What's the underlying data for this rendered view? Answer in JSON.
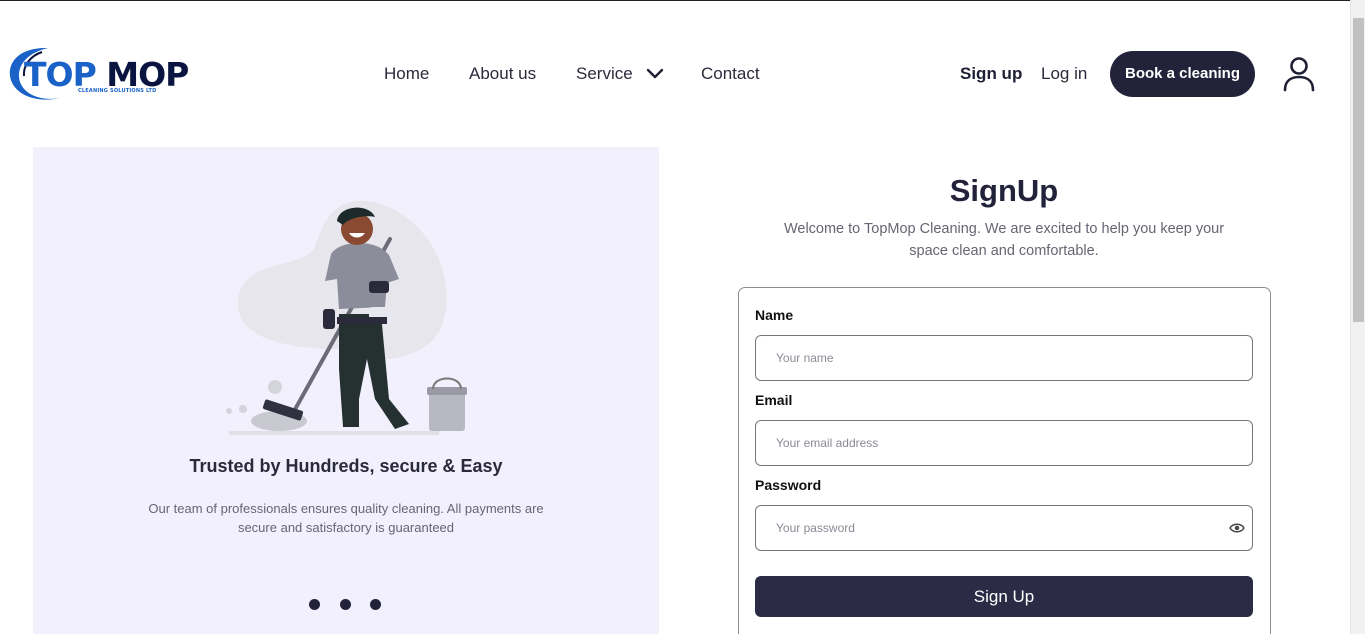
{
  "header": {
    "logo": {
      "brand_top": "TOP",
      "brand_mop": "MOP",
      "tagline": "CLEANING SOLUTIONS LTD"
    },
    "nav": {
      "home": "Home",
      "about": "About us",
      "service": "Service",
      "contact": "Contact"
    },
    "signup_label": "Sign up",
    "login_label": "Log in",
    "book_label": "Book a cleaning",
    "icons": {
      "service_dropdown": "chevron-down-icon",
      "account": "user-icon"
    }
  },
  "hero": {
    "title": "Trusted by Hundreds, secure & Easy",
    "description": "Our team of professionals ensures quality cleaning. All payments are secure and satisfactory is guaranteed",
    "carousel_dots": 3
  },
  "form": {
    "title": "SignUp",
    "subtitle": "Welcome to TopMop Cleaning. We are excited to help you keep your space clean and comfortable.",
    "name_label": "Name",
    "name_placeholder": "Your name",
    "email_label": "Email",
    "email_placeholder": "Your email address",
    "password_label": "Password",
    "password_placeholder": "Your password",
    "submit_label": "Sign Up",
    "icons": {
      "password_toggle": "eye-icon"
    }
  },
  "colors": {
    "primary": "#23223b",
    "panel_bg": "#f1f0fc",
    "logo_blue": "#1a62c7",
    "logo_navy": "#0a1440"
  }
}
